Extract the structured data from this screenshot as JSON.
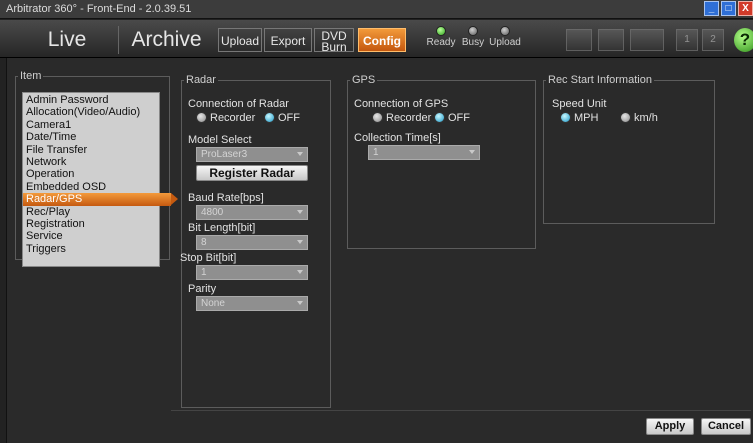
{
  "window": {
    "title": "Arbitrator 360° - Front-End - 2.0.39.51",
    "min_label": "_",
    "max_label": "□",
    "close_label": "X"
  },
  "toolbar": {
    "tabs": {
      "live": "Live",
      "archive": "Archive",
      "upload": "Upload",
      "export": "Export",
      "dvd_line1": "DVD",
      "dvd_line2": "Burn",
      "config": "Config"
    },
    "indicators": {
      "ready": "Ready",
      "busy": "Busy",
      "upload": "Upload"
    },
    "icon_labels": {
      "btn1": "1",
      "btn2": "2"
    },
    "help_label": "?"
  },
  "item_panel": {
    "legend": "Item",
    "items": [
      "Admin Password",
      "Allocation(Video/Audio)",
      "Camera1",
      "Date/Time",
      "File Transfer",
      "Network",
      "Operation",
      "Embedded OSD",
      "Radar/GPS",
      "Rec/Play",
      "Registration",
      "Service",
      "Triggers"
    ],
    "selected": "Radar/GPS"
  },
  "radar": {
    "legend": "Radar",
    "connection_label": "Connection of Radar",
    "option_recorder": "Recorder",
    "option_off": "OFF",
    "connection_value": "OFF",
    "model_label": "Model Select",
    "model_value": "ProLaser3",
    "register_button": "Register Radar",
    "baud_label": "Baud Rate[bps]",
    "baud_value": "4800",
    "bit_length_label": "Bit Length[bit]",
    "bit_length_value": "8",
    "stop_bit_label": "Stop Bit[bit]",
    "stop_bit_value": "1",
    "parity_label": "Parity",
    "parity_value": "None"
  },
  "gps": {
    "legend": "GPS",
    "connection_label": "Connection of GPS",
    "option_recorder": "Recorder",
    "option_off": "OFF",
    "connection_value": "OFF",
    "collection_label": "Collection Time[s]",
    "collection_value": "1"
  },
  "rec_start": {
    "legend": "Rec Start Information",
    "speed_unit_label": "Speed Unit",
    "option_mph": "MPH",
    "option_kmh": "km/h",
    "speed_unit_value": "MPH"
  },
  "footer": {
    "apply": "Apply",
    "cancel": "Cancel"
  },
  "colors": {
    "accent": "#e07a1f",
    "background": "#2a2a2a",
    "led_ready": "#2fa11c",
    "radio_checked": "#1b98c8"
  }
}
